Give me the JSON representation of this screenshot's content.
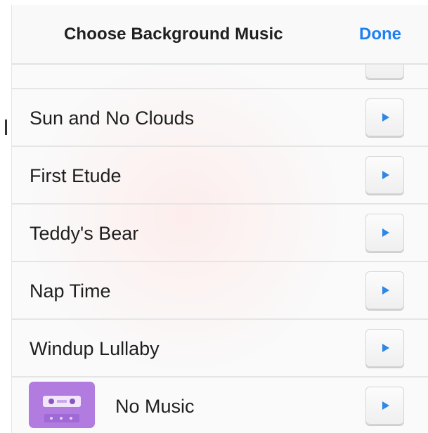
{
  "header": {
    "title": "Choose Background Music",
    "done_label": "Done"
  },
  "tracks": [
    {
      "label": "",
      "icon": "play-icon"
    },
    {
      "label": "Sun and No Clouds",
      "icon": "play-icon"
    },
    {
      "label": "First Etude",
      "icon": "play-icon"
    },
    {
      "label": "Teddy's Bear",
      "icon": "play-icon"
    },
    {
      "label": "Nap Time",
      "icon": "play-icon"
    },
    {
      "label": "Windup Lullaby",
      "icon": "play-icon"
    },
    {
      "label": "No Music",
      "icon": "cassette-icon"
    }
  ],
  "colors": {
    "accent": "#1e7ff0",
    "cassette": "#b27be0"
  }
}
